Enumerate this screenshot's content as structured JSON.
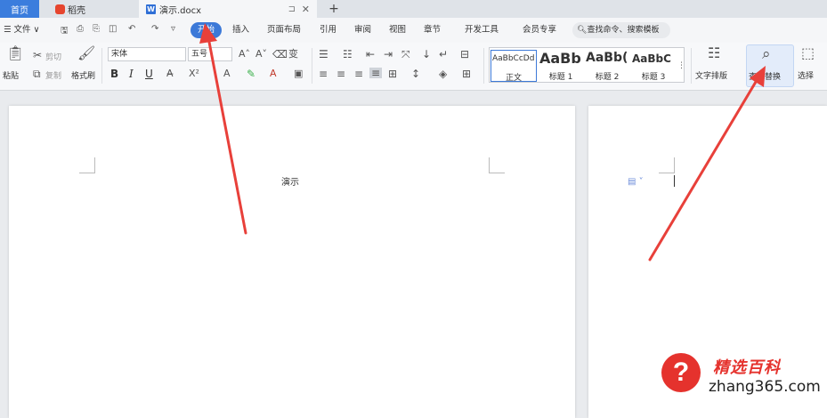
{
  "tabs": {
    "home": "首页",
    "docer": "稻壳",
    "document": "演示.docx",
    "pin": "⊐",
    "close": "✕",
    "add": "+"
  },
  "menu": {
    "file": "☰ 文件 ∨",
    "items": [
      "开始",
      "插入",
      "页面布局",
      "引用",
      "审阅",
      "视图",
      "章节",
      "开发工具",
      "会员专享"
    ],
    "search": "查找命令、搜索模板"
  },
  "ribbon": {
    "paste": "粘贴",
    "cut": "剪切",
    "copy": "复制",
    "format_painter": "格式刷",
    "font": "宋体",
    "size": "五号",
    "bold": "B",
    "italic": "I",
    "underline": "U",
    "styles": [
      {
        "preview": "AaBbCcDd",
        "name": "正文"
      },
      {
        "preview": "AaBb",
        "name": "标题 1"
      },
      {
        "preview": "AaBb(",
        "name": "标题 2"
      },
      {
        "preview": "AaBbC",
        "name": "标题 3"
      }
    ],
    "text_layout": "文字排版",
    "find_replace": "查找替换",
    "select": "选择"
  },
  "document": {
    "page1_text": "演示"
  },
  "watermark": {
    "title": "精选百科",
    "url": "zhang365.com"
  },
  "colors": {
    "accent": "#3c79d8",
    "arrow": "#e8403a"
  }
}
